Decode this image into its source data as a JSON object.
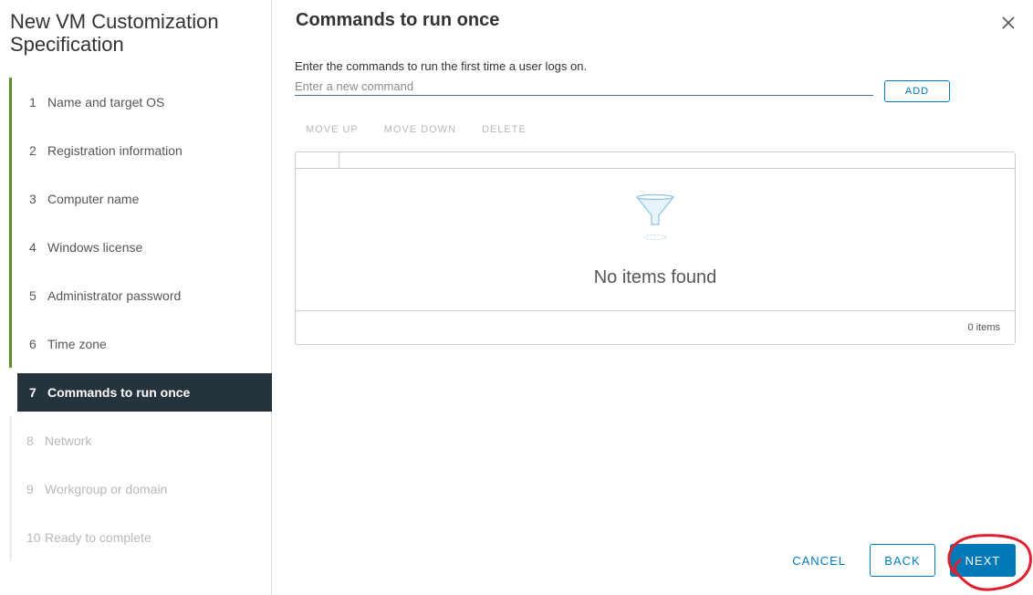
{
  "wizard": {
    "title": "New VM Customization Specification",
    "steps": [
      {
        "num": "1",
        "label": "Name and target OS",
        "state": "done"
      },
      {
        "num": "2",
        "label": "Registration information",
        "state": "done"
      },
      {
        "num": "3",
        "label": "Computer name",
        "state": "done"
      },
      {
        "num": "4",
        "label": "Windows license",
        "state": "done"
      },
      {
        "num": "5",
        "label": "Administrator password",
        "state": "done"
      },
      {
        "num": "6",
        "label": "Time zone",
        "state": "done"
      },
      {
        "num": "7",
        "label": "Commands to run once",
        "state": "current"
      },
      {
        "num": "8",
        "label": "Network",
        "state": "todo"
      },
      {
        "num": "9",
        "label": "Workgroup or domain",
        "state": "todo"
      },
      {
        "num": "10",
        "label": "Ready to complete",
        "state": "todo"
      }
    ]
  },
  "page": {
    "title": "Commands to run once",
    "instruction": "Enter the commands to run the first time a user logs on.",
    "command_input": {
      "value": "",
      "placeholder": "Enter a new command"
    },
    "add_label": "ADD"
  },
  "actions": {
    "move_up": "MOVE UP",
    "move_down": "MOVE DOWN",
    "delete": "DELETE"
  },
  "grid": {
    "empty_text": "No items found",
    "count_text": "0 items",
    "empty_icon": "funnel-icon"
  },
  "footer": {
    "cancel": "CANCEL",
    "back": "BACK",
    "next": "NEXT"
  },
  "colors": {
    "accent": "#0079b8",
    "done_step": "#5a8f29",
    "current_step_bg": "#25333d",
    "annotation": "#e0202e"
  }
}
